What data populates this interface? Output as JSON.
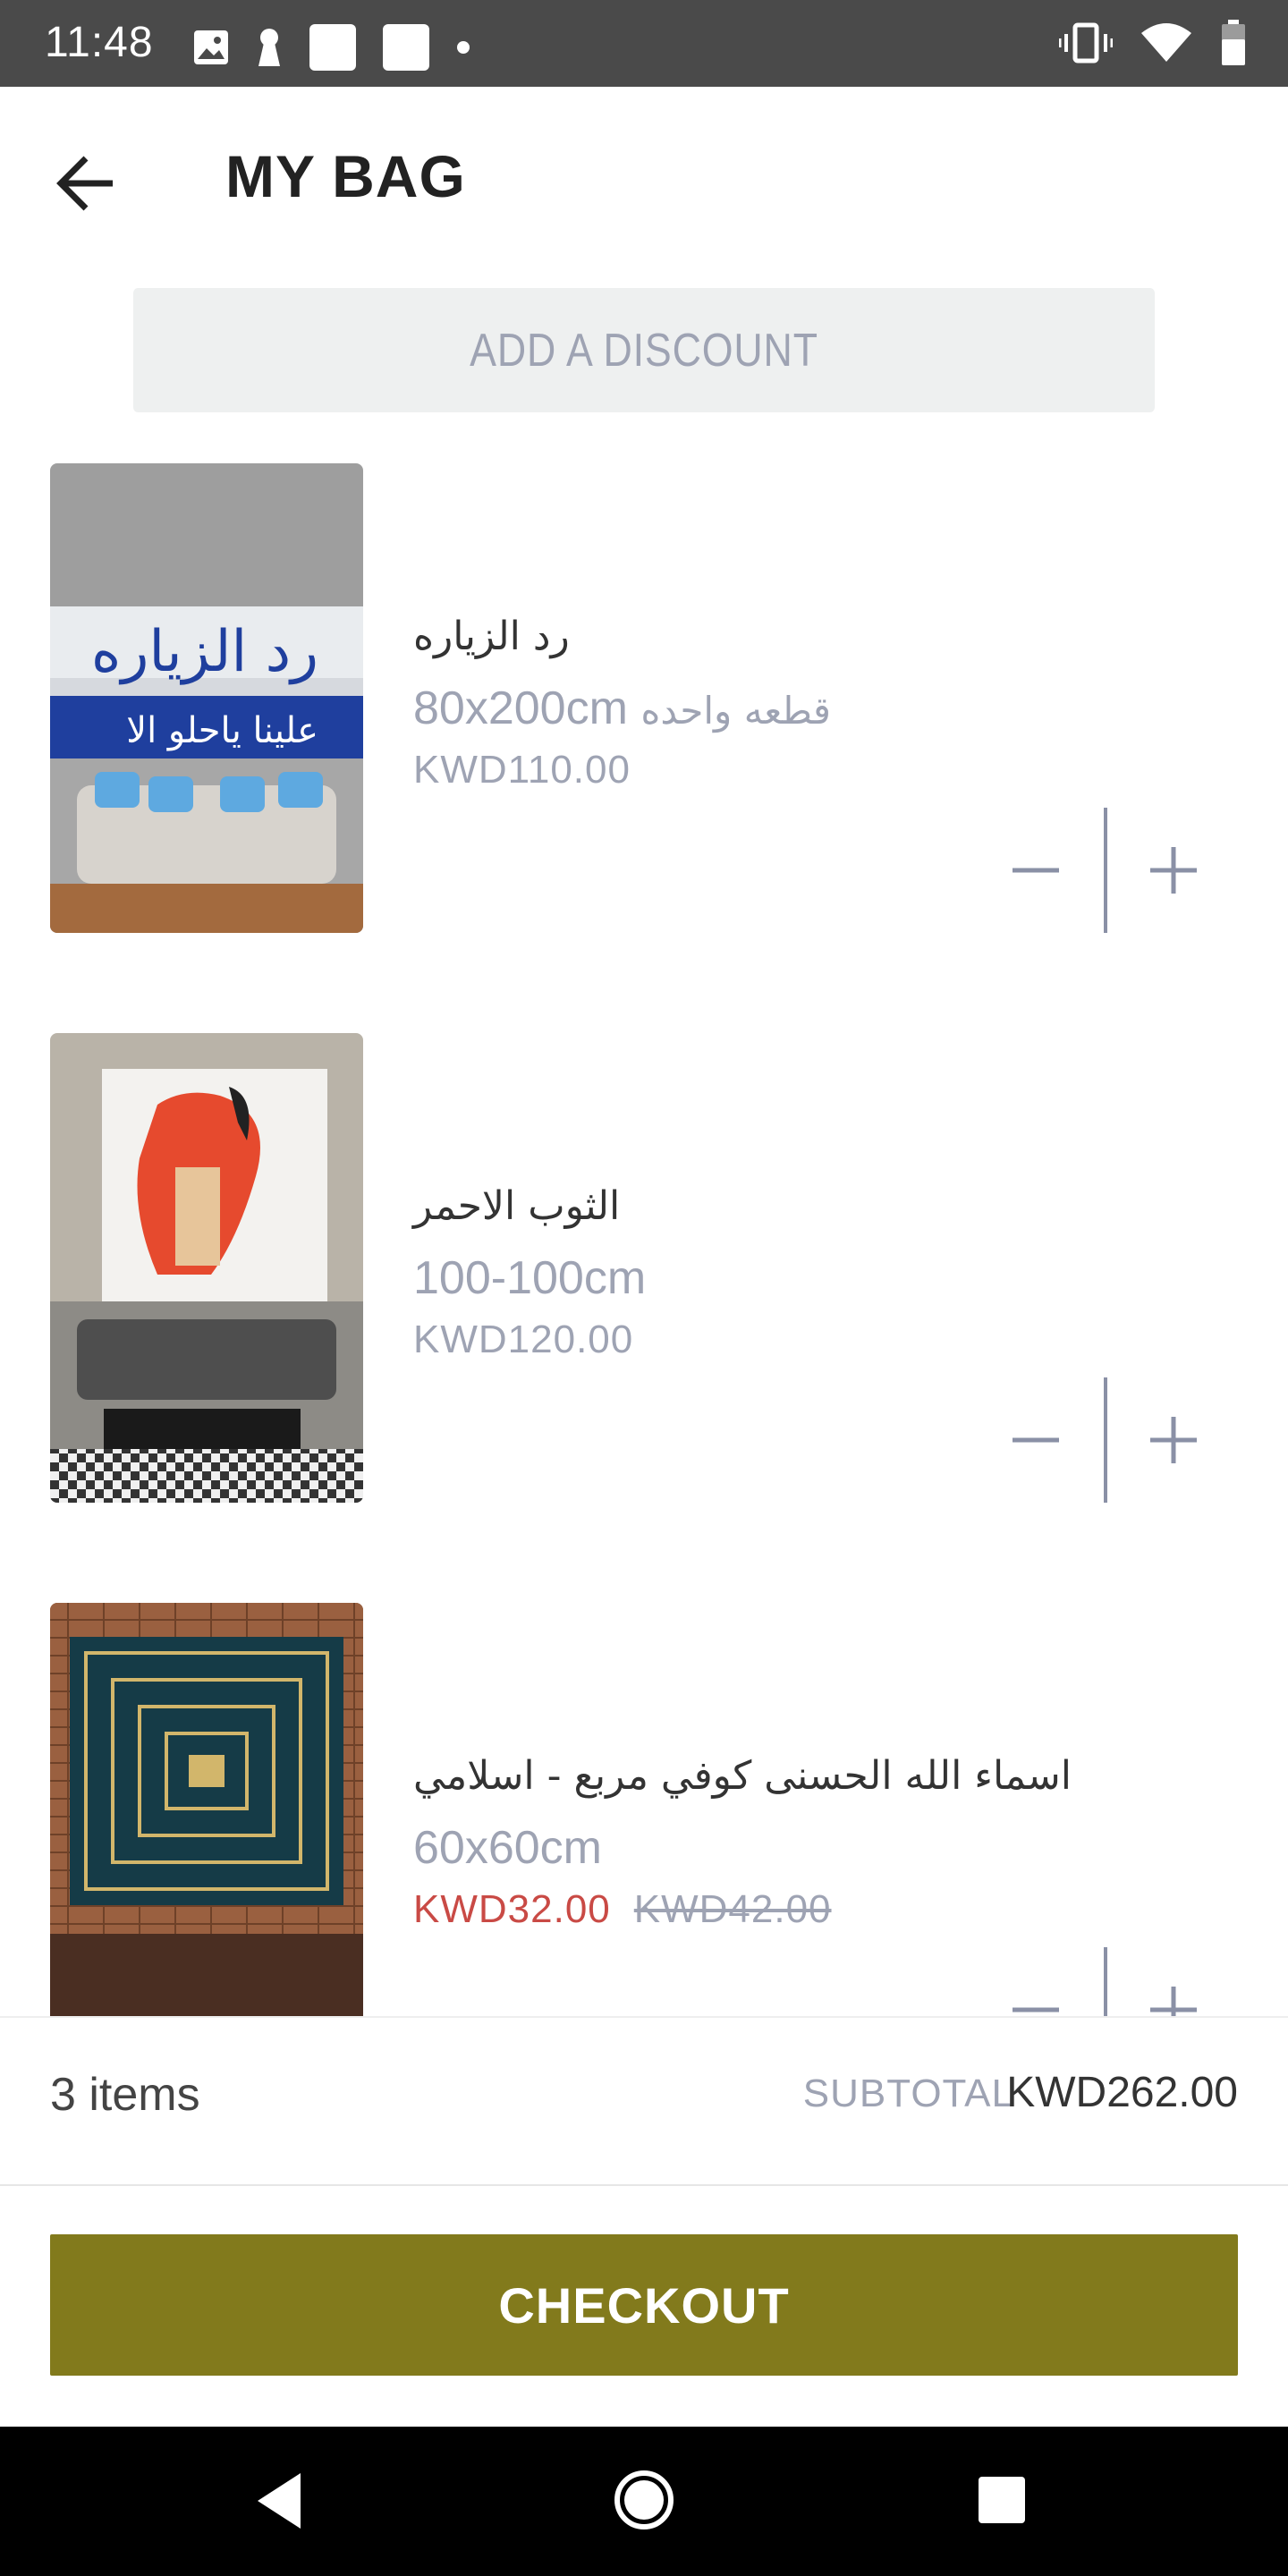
{
  "status_bar": {
    "time": "11:48",
    "left_icons": [
      "image-icon",
      "keyhole-icon",
      "square-icon",
      "square-icon",
      "dot-icon"
    ],
    "right_icons": [
      "vibrate-icon",
      "wifi-icon",
      "battery-icon"
    ]
  },
  "header": {
    "title": "MY BAG",
    "back_icon": "arrow-left-icon"
  },
  "discount": {
    "label": "ADD A DISCOUNT"
  },
  "items": [
    {
      "name": "رد الزياره",
      "size": "80x200cm",
      "variant": "قطعه واحده",
      "price": "KWD110.00"
    },
    {
      "name": "الثوب الاحمر",
      "size": "100-100cm",
      "price": "KWD120.00"
    },
    {
      "name": "اسماء الله الحسنى كوفي مربع - اسلامي",
      "size": "60x60cm",
      "price": "KWD32.00",
      "old_price": "KWD42.00"
    }
  ],
  "summary": {
    "count": "3 items",
    "subtotal_label": "SUBTOTAL",
    "subtotal_value": "KWD262.00"
  },
  "checkout": {
    "label": "CHECKOUT",
    "color": "#827a1c"
  },
  "nav_bar": {
    "icons": [
      "nav-back-icon",
      "nav-home-icon",
      "nav-recent-icon"
    ]
  }
}
